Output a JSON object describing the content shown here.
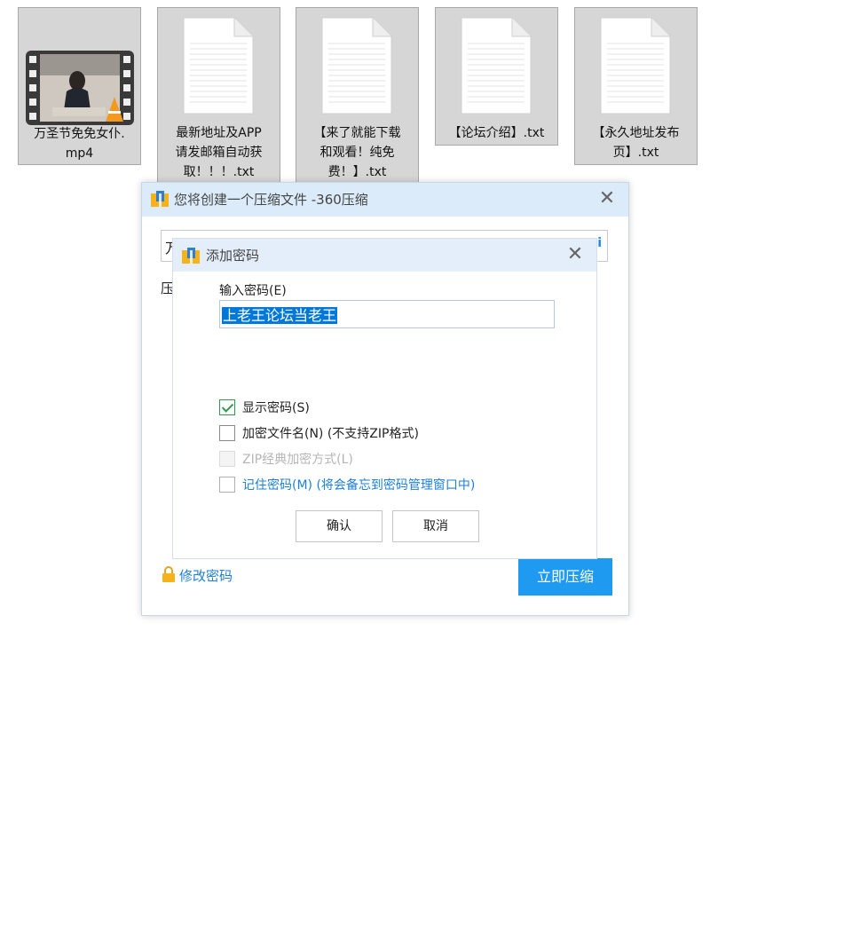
{
  "desktop": {
    "files": [
      {
        "name": "万圣节免免女仆.mp4",
        "line1": "万圣节免免女仆.",
        "line2": "mp4",
        "icon": "video-file-icon"
      },
      {
        "name": "最新地址及APP请发邮箱自动获取！！！.txt",
        "line1": "最新地址及APP",
        "line2": "请发邮箱自动获",
        "line3": "取！！！.txt",
        "icon": "text-file-icon"
      },
      {
        "name": "【来了就能下载和观看！纯免费！】.txt",
        "line1": "【来了就能下载",
        "line2": "和观看！纯免",
        "line3": "费！】.txt",
        "icon": "text-file-icon"
      },
      {
        "name": "【论坛介绍】.txt",
        "line1": "【论坛介绍】.txt",
        "icon": "text-file-icon"
      },
      {
        "name": "【永久地址发布页】.txt",
        "line1": "【永久地址发布",
        "line2": "页】.txt",
        "icon": "text-file-icon"
      }
    ]
  },
  "main_dialog": {
    "title": "您将创建一个压缩文件 -360压缩",
    "close_label": "✕",
    "path_value_visible": "万",
    "row_label_visible": "压",
    "modify_password_label": "修改密码",
    "compress_now_label": "立即压缩",
    "accent_color": "#1e9af0"
  },
  "password_dialog": {
    "title": "添加密码",
    "close_label": "✕",
    "input_label": "输入密码(E)",
    "input_value": "上老王论坛当老王",
    "options": {
      "show_password": {
        "label": "显示密码(S)",
        "checked": true
      },
      "encrypt_filename": {
        "label": "加密文件名(N) (不支持ZIP格式)",
        "checked": false
      },
      "zip_classic": {
        "label": "ZIP经典加密方式(L)",
        "checked": false,
        "disabled": true
      },
      "remember_password": {
        "label": "记住密码(M) (将会备忘到密码管理窗口中)",
        "checked": false
      }
    },
    "confirm_label": "确认",
    "cancel_label": "取消"
  }
}
